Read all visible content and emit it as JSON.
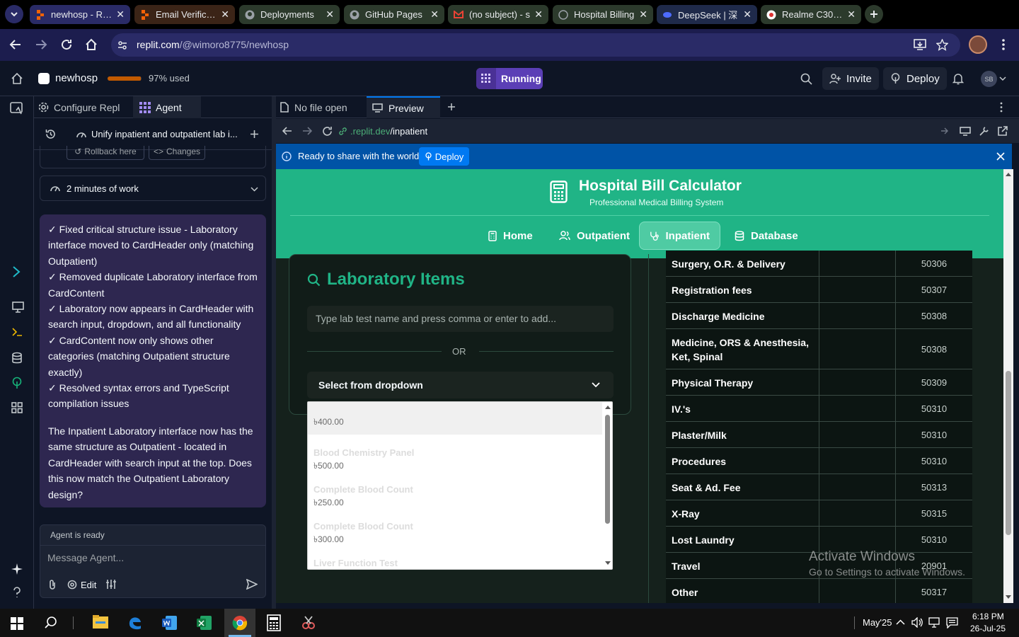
{
  "browser": {
    "tabs": [
      {
        "title": "newhosp - Replit",
        "active": true
      },
      {
        "title": "Email Verification"
      },
      {
        "title": "Deployments"
      },
      {
        "title": "GitHub Pages"
      },
      {
        "title": "(no subject) - s"
      },
      {
        "title": "Hospital Billing"
      },
      {
        "title": "DeepSeek | 深"
      },
      {
        "title": "Realme C30 (C"
      }
    ],
    "url_host": "replit.com",
    "url_path": "/@wimoro8775/newhosp"
  },
  "replit": {
    "project": "newhosp",
    "usage": "97% used",
    "usage_fraction": 0.97,
    "run_state": "Running",
    "invite": "Invite",
    "deploy": "Deploy",
    "avatar": "SB"
  },
  "panel_tabs": {
    "configure": "Configure Repl",
    "agent": "Agent",
    "no_file": "No file open",
    "preview": "Preview"
  },
  "agent": {
    "thread_title": "Unify inpatient and outpatient lab i...",
    "rollback": "Rollback here",
    "changes": "Changes",
    "work_time": "2 minutes of work",
    "lines": [
      "✓ Fixed critical structure issue - Laboratory interface moved to CardHeader only (matching Outpatient)",
      "✓ Removed duplicate Laboratory interface from CardContent",
      "✓ Laboratory now appears in CardHeader with search input, dropdown, and all functionality",
      "✓ CardContent now only shows other categories (matching Outpatient structure exactly)",
      "✓ Resolved syntax errors and TypeScript compilation issues"
    ],
    "summary": "The Inpatient Laboratory interface now has the same structure as Outpatient - located in CardHeader with search input at the top. Does this now match the Outpatient Laboratory design?",
    "status": "Agent is ready",
    "input_placeholder": "Message Agent...",
    "edit": "Edit"
  },
  "preview": {
    "url_prefix": ".replit.dev",
    "url_path": "/inpatient",
    "banner": "Ready to share with the world?",
    "banner_button": "Deploy"
  },
  "app": {
    "title": "Hospital Bill Calculator",
    "subtitle": "Professional Medical Billing System",
    "nav": [
      "Home",
      "Outpatient",
      "Inpatient",
      "Database"
    ],
    "lab_title": "Laboratory Items",
    "lab_placeholder": "Type lab test name and press comma or enter to add...",
    "or": "OR",
    "select_label": "Select from dropdown",
    "dropdown_options": [
      {
        "name": "",
        "price": "৳400.00"
      },
      {
        "name": "Blood Chemistry Panel",
        "price": "৳500.00"
      },
      {
        "name": "Complete Blood Count",
        "price": "৳250.00"
      },
      {
        "name": "Complete Blood Count",
        "price": "৳300.00"
      },
      {
        "name": "Liver Function Test",
        "price": ""
      }
    ],
    "rows": [
      {
        "name": "Surgery, O.R. & Delivery",
        "code": "50306"
      },
      {
        "name": "Registration fees",
        "code": "50307"
      },
      {
        "name": "Discharge Medicine",
        "code": "50308"
      },
      {
        "name": "Medicine, ORS & Anesthesia, Ket, Spinal",
        "code": "50308"
      },
      {
        "name": "Physical Therapy",
        "code": "50309"
      },
      {
        "name": "IV.'s",
        "code": "50310"
      },
      {
        "name": "Plaster/Milk",
        "code": "50310"
      },
      {
        "name": "Procedures",
        "code": "50310"
      },
      {
        "name": "Seat & Ad. Fee",
        "code": "50313"
      },
      {
        "name": "X-Ray",
        "code": "50315"
      },
      {
        "name": "Lost Laundry",
        "code": "50310"
      },
      {
        "name": "Travel",
        "code": "20901"
      },
      {
        "name": "Other",
        "code": "50317"
      }
    ]
  },
  "watermark": {
    "line1": "Activate Windows",
    "line2": "Go to Settings to activate Windows."
  },
  "taskbar": {
    "tray_text": "May'25",
    "time": "6:18 PM",
    "date": "26-Jul-25"
  }
}
